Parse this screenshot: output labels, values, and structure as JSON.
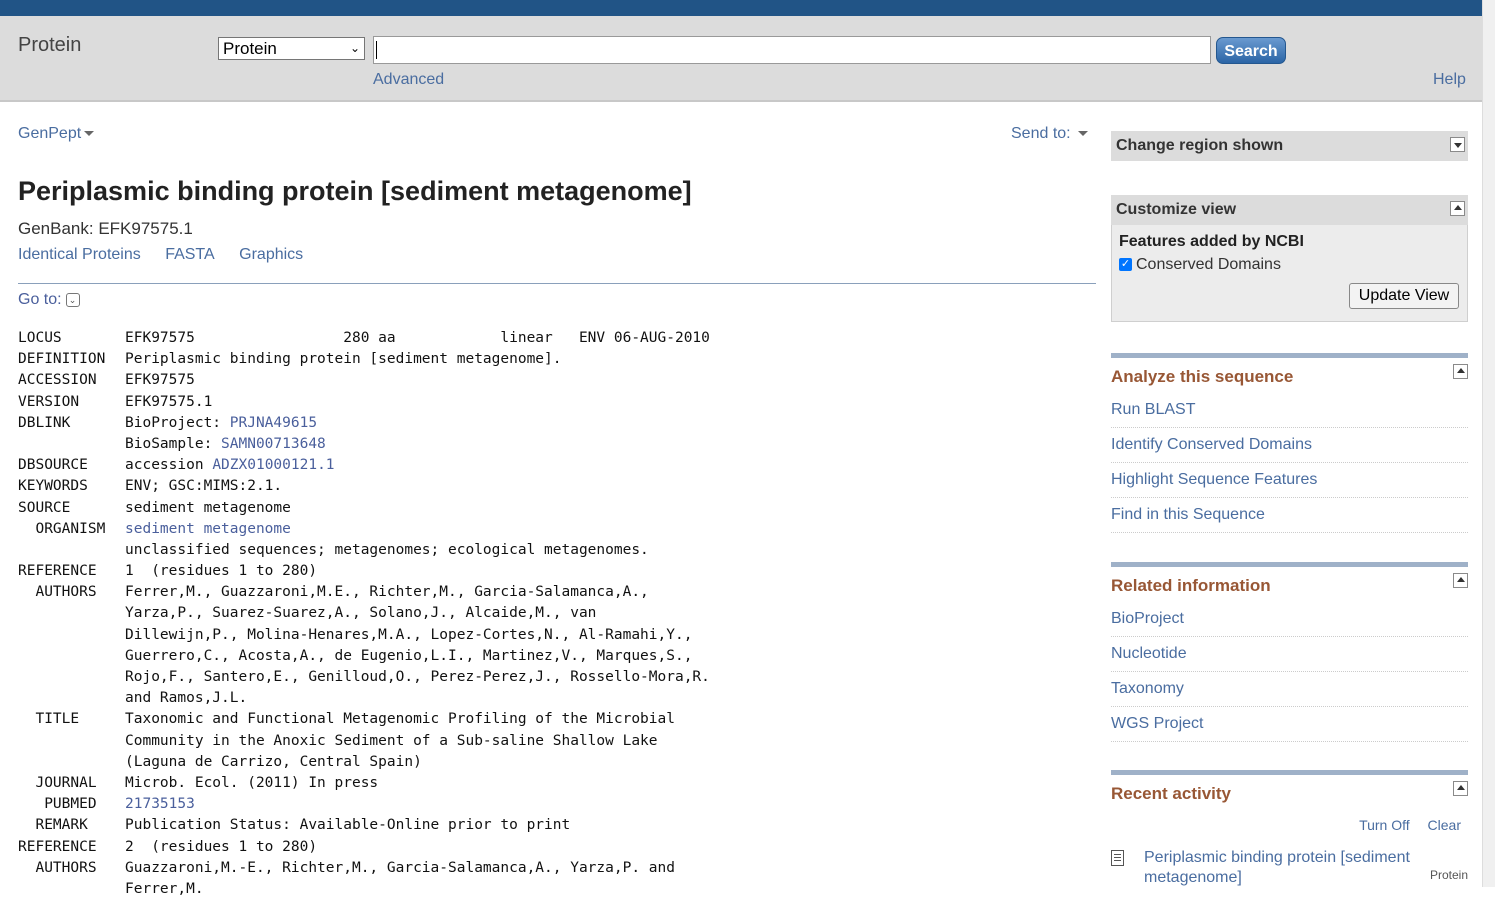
{
  "header": {
    "db_title": "Protein",
    "db_selected": "Protein",
    "search_placeholder": "",
    "search_button": "Search",
    "advanced": "Advanced",
    "help": "Help"
  },
  "toolbar": {
    "format": "GenPept",
    "send_to": "Send to:"
  },
  "record": {
    "title": "Periplasmic binding protein [sediment metagenome]",
    "accession_line": "GenBank: EFK97575.1",
    "links": [
      "Identical Proteins",
      "FASTA",
      "Graphics"
    ],
    "goto": "Go to:"
  },
  "flatfile": [
    {
      "key": "LOCUS",
      "value": "EFK97575                 280 aa            linear   ENV 06-AUG-2010"
    },
    {
      "key": "DEFINITION",
      "value": "Periplasmic binding protein [sediment metagenome]."
    },
    {
      "key": "ACCESSION",
      "value": "EFK97575"
    },
    {
      "key": "VERSION",
      "value": "EFK97575.1"
    },
    {
      "key": "DBLINK",
      "prefix": "BioProject: ",
      "link": "PRJNA49615"
    },
    {
      "key": "",
      "prefix": "BioSample: ",
      "link": "SAMN00713648"
    },
    {
      "key": "DBSOURCE",
      "prefix": "accession ",
      "link": "ADZX01000121.1"
    },
    {
      "key": "KEYWORDS",
      "value": "ENV; GSC:MIMS:2.1."
    },
    {
      "key": "SOURCE",
      "value": "sediment metagenome"
    },
    {
      "key": "  ORGANISM",
      "prefix": "",
      "link": "sediment metagenome"
    },
    {
      "key": "",
      "value": "unclassified sequences; metagenomes; ecological metagenomes."
    },
    {
      "key": "REFERENCE",
      "value": "1  (residues 1 to 280)"
    },
    {
      "key": "  AUTHORS",
      "value": "Ferrer,M., Guazzaroni,M.E., Richter,M., Garcia-Salamanca,A.,"
    },
    {
      "key": "",
      "value": "Yarza,P., Suarez-Suarez,A., Solano,J., Alcaide,M., van"
    },
    {
      "key": "",
      "value": "Dillewijn,P., Molina-Henares,M.A., Lopez-Cortes,N., Al-Ramahi,Y.,"
    },
    {
      "key": "",
      "value": "Guerrero,C., Acosta,A., de Eugenio,L.I., Martinez,V., Marques,S.,"
    },
    {
      "key": "",
      "value": "Rojo,F., Santero,E., Genilloud,O., Perez-Perez,J., Rossello-Mora,R."
    },
    {
      "key": "",
      "value": "and Ramos,J.L."
    },
    {
      "key": "  TITLE",
      "value": "Taxonomic and Functional Metagenomic Profiling of the Microbial"
    },
    {
      "key": "",
      "value": "Community in the Anoxic Sediment of a Sub-saline Shallow Lake"
    },
    {
      "key": "",
      "value": "(Laguna de Carrizo, Central Spain)"
    },
    {
      "key": "  JOURNAL",
      "value": "Microb. Ecol. (2011) In press"
    },
    {
      "key": "   PUBMED",
      "prefix": "",
      "link": "21735153"
    },
    {
      "key": "  REMARK",
      "value": "Publication Status: Available-Online prior to print"
    },
    {
      "key": "REFERENCE",
      "value": "2  (residues 1 to 280)"
    },
    {
      "key": "  AUTHORS",
      "value": "Guazzaroni,M.-E., Richter,M., Garcia-Salamanca,A., Yarza,P. and"
    },
    {
      "key": "",
      "value": "Ferrer,M."
    }
  ],
  "sidebar": {
    "change_region": "Change region shown",
    "customize": {
      "title": "Customize view",
      "subtitle": "Features added by NCBI",
      "checkbox_label": "Conserved Domains",
      "checkbox_checked": true,
      "button": "Update View"
    },
    "analyze": {
      "title": "Analyze this sequence",
      "items": [
        "Run BLAST",
        "Identify Conserved Domains",
        "Highlight Sequence Features",
        "Find in this Sequence"
      ]
    },
    "related": {
      "title": "Related information",
      "items": [
        "BioProject",
        "Nucleotide",
        "Taxonomy",
        "WGS Project"
      ]
    },
    "recent": {
      "title": "Recent activity",
      "turn_off": "Turn Off",
      "clear": "Clear",
      "items": [
        {
          "title": "Periplasmic binding protein [sediment metagenome]",
          "db": "Protein",
          "icon": "document-icon"
        }
      ]
    }
  },
  "colors": {
    "top_strip": "#215486",
    "header_bg": "#dcdcdc",
    "link": "#4a6da0",
    "section_title": "#985735"
  }
}
